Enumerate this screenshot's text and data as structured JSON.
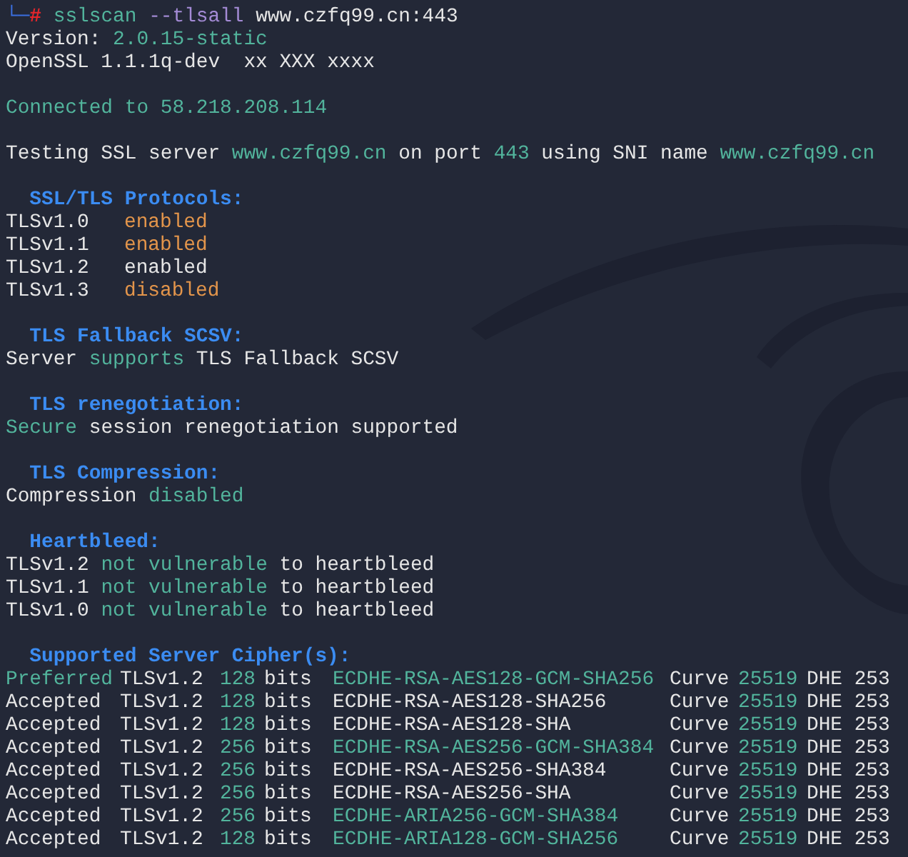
{
  "blocks": [
    {
      "lines": [
        {
          "kind": "command",
          "branch": "└─",
          "symbol": "#",
          "program": "sslscan",
          "option": "--tlsall",
          "target": "www.czfq99.cn:443"
        },
        {
          "kind": "segments",
          "parts": [
            {
              "text": "Version:",
              "color": "#e6e6e6"
            },
            {
              "text": "2.0.15-static",
              "color": "#52b49c"
            }
          ]
        },
        {
          "kind": "segments",
          "parts": [
            {
              "text": "OpenSSL 1.1.1q-dev  xx XXX xxxx",
              "color": "#e6e6e6"
            }
          ]
        }
      ]
    },
    {
      "lines": [
        {
          "kind": "segments",
          "parts": [
            {
              "text": "Connected to 58.218.208.114",
              "color": "#52b49c"
            }
          ]
        }
      ]
    },
    {
      "lines": [
        {
          "kind": "segments",
          "parts": [
            {
              "text": "Testing SSL server",
              "color": "#e6e6e6"
            },
            {
              "text": "www.czfq99.cn",
              "color": "#52b49c"
            },
            {
              "text": "on port",
              "color": "#e6e6e6"
            },
            {
              "text": "443",
              "color": "#52b49c"
            },
            {
              "text": "using SNI name",
              "color": "#e6e6e6"
            },
            {
              "text": "www.czfq99.cn",
              "color": "#52b49c"
            }
          ]
        }
      ]
    },
    {
      "lines": [
        {
          "kind": "heading",
          "text": "SSL/TLS Protocols:"
        },
        {
          "kind": "protocol",
          "name": "TLSv1.0",
          "state": "enabled",
          "color": "#e3954b"
        },
        {
          "kind": "protocol",
          "name": "TLSv1.1",
          "state": "enabled",
          "color": "#e3954b"
        },
        {
          "kind": "protocol",
          "name": "TLSv1.2",
          "state": "enabled",
          "color": "#e6e6e6"
        },
        {
          "kind": "protocol",
          "name": "TLSv1.3",
          "state": "disabled",
          "color": "#e3954b"
        }
      ]
    },
    {
      "lines": [
        {
          "kind": "heading",
          "text": "TLS Fallback SCSV:"
        },
        {
          "kind": "segments",
          "parts": [
            {
              "text": "Server",
              "color": "#e6e6e6"
            },
            {
              "text": "supports",
              "color": "#52b49c"
            },
            {
              "text": "TLS Fallback SCSV",
              "color": "#e6e6e6"
            }
          ]
        }
      ]
    },
    {
      "lines": [
        {
          "kind": "heading",
          "text": "TLS renegotiation:"
        },
        {
          "kind": "segments",
          "parts": [
            {
              "text": "Secure",
              "color": "#52b49c"
            },
            {
              "text": "session renegotiation supported",
              "color": "#e6e6e6"
            }
          ]
        }
      ]
    },
    {
      "lines": [
        {
          "kind": "heading",
          "text": "TLS Compression:"
        },
        {
          "kind": "segments",
          "parts": [
            {
              "text": "Compression",
              "color": "#e6e6e6"
            },
            {
              "text": "disabled",
              "color": "#52b49c"
            }
          ]
        }
      ]
    },
    {
      "lines": [
        {
          "kind": "heading",
          "text": "Heartbleed:"
        },
        {
          "kind": "segments",
          "parts": [
            {
              "text": "TLSv1.2",
              "color": "#e6e6e6"
            },
            {
              "text": "not vulnerable",
              "color": "#52b49c"
            },
            {
              "text": "to heartbleed",
              "color": "#e6e6e6"
            }
          ]
        },
        {
          "kind": "segments",
          "parts": [
            {
              "text": "TLSv1.1",
              "color": "#e6e6e6"
            },
            {
              "text": "not vulnerable",
              "color": "#52b49c"
            },
            {
              "text": "to heartbleed",
              "color": "#e6e6e6"
            }
          ]
        },
        {
          "kind": "segments",
          "parts": [
            {
              "text": "TLSv1.0",
              "color": "#e6e6e6"
            },
            {
              "text": "not vulnerable",
              "color": "#52b49c"
            },
            {
              "text": "to heartbleed",
              "color": "#e6e6e6"
            }
          ]
        }
      ]
    },
    {
      "lines": [
        {
          "kind": "heading",
          "text": "Supported Server Cipher(s):"
        },
        {
          "kind": "cipher",
          "status": {
            "text": "Preferred",
            "color": "#52b49c"
          },
          "protocol": "TLSv1.2",
          "bits": "128",
          "bits_label": "bits",
          "cipher": {
            "text": "ECDHE-RSA-AES128-GCM-SHA256",
            "color": "#52b49c"
          },
          "curve_label": "Curve",
          "curve": "25519",
          "dhe": "DHE 253"
        },
        {
          "kind": "cipher",
          "status": {
            "text": "Accepted",
            "color": "#e6e6e6"
          },
          "protocol": "TLSv1.2",
          "bits": "128",
          "bits_label": "bits",
          "cipher": {
            "text": "ECDHE-RSA-AES128-SHA256",
            "color": "#e6e6e6"
          },
          "curve_label": "Curve",
          "curve": "25519",
          "dhe": "DHE 253"
        },
        {
          "kind": "cipher",
          "status": {
            "text": "Accepted",
            "color": "#e6e6e6"
          },
          "protocol": "TLSv1.2",
          "bits": "128",
          "bits_label": "bits",
          "cipher": {
            "text": "ECDHE-RSA-AES128-SHA",
            "color": "#e6e6e6"
          },
          "curve_label": "Curve",
          "curve": "25519",
          "dhe": "DHE 253"
        },
        {
          "kind": "cipher",
          "status": {
            "text": "Accepted",
            "color": "#e6e6e6"
          },
          "protocol": "TLSv1.2",
          "bits": "256",
          "bits_label": "bits",
          "cipher": {
            "text": "ECDHE-RSA-AES256-GCM-SHA384",
            "color": "#52b49c"
          },
          "curve_label": "Curve",
          "curve": "25519",
          "dhe": "DHE 253"
        },
        {
          "kind": "cipher",
          "status": {
            "text": "Accepted",
            "color": "#e6e6e6"
          },
          "protocol": "TLSv1.2",
          "bits": "256",
          "bits_label": "bits",
          "cipher": {
            "text": "ECDHE-RSA-AES256-SHA384",
            "color": "#e6e6e6"
          },
          "curve_label": "Curve",
          "curve": "25519",
          "dhe": "DHE 253"
        },
        {
          "kind": "cipher",
          "status": {
            "text": "Accepted",
            "color": "#e6e6e6"
          },
          "protocol": "TLSv1.2",
          "bits": "256",
          "bits_label": "bits",
          "cipher": {
            "text": "ECDHE-RSA-AES256-SHA",
            "color": "#e6e6e6"
          },
          "curve_label": "Curve",
          "curve": "25519",
          "dhe": "DHE 253"
        },
        {
          "kind": "cipher",
          "status": {
            "text": "Accepted",
            "color": "#e6e6e6"
          },
          "protocol": "TLSv1.2",
          "bits": "256",
          "bits_label": "bits",
          "cipher": {
            "text": "ECDHE-ARIA256-GCM-SHA384",
            "color": "#52b49c"
          },
          "curve_label": "Curve",
          "curve": "25519",
          "dhe": "DHE 253"
        },
        {
          "kind": "cipher",
          "status": {
            "text": "Accepted",
            "color": "#e6e6e6"
          },
          "protocol": "TLSv1.2",
          "bits": "128",
          "bits_label": "bits",
          "cipher": {
            "text": "ECDHE-ARIA128-GCM-SHA256",
            "color": "#52b49c"
          },
          "curve_label": "Curve",
          "curve": "25519",
          "dhe": "DHE 253"
        }
      ]
    }
  ]
}
